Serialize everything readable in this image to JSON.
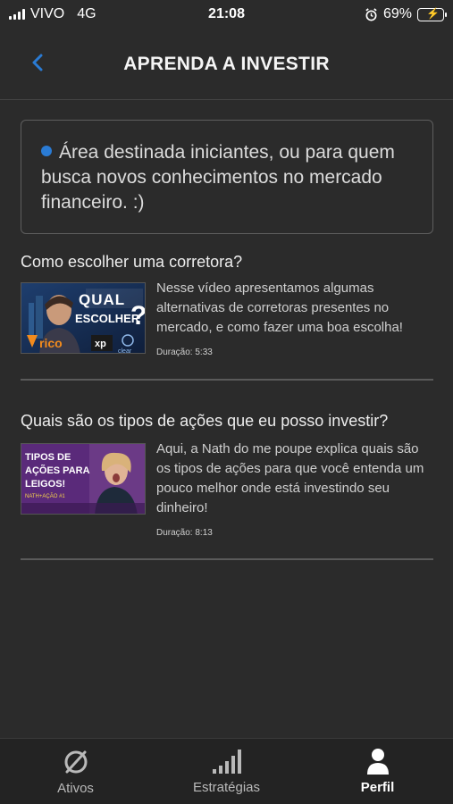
{
  "status_bar": {
    "carrier": "VIVO",
    "network": "4G",
    "time": "21:08",
    "battery": "69%"
  },
  "header": {
    "title": "APRENDA A INVESTIR"
  },
  "info_box": {
    "text": "Área destinada iniciantes, ou para quem busca novos conhecimentos no mercado financeiro. :)"
  },
  "videos": [
    {
      "title": "Como escolher uma corretora?",
      "thumbnail_text": "QUAL ESCOLHER?",
      "thumbnail_brands": [
        "rico",
        "xp",
        "clear"
      ],
      "description": "Nesse vídeo apresentamos algumas alternativas de corretoras presentes no mercado, e como fazer uma boa escolha!",
      "duration": "Duração: 5:33"
    },
    {
      "title": "Quais são os tipos de ações que eu posso investir?",
      "thumbnail_text": "TIPOS DE AÇÕES PARA LEIGOS!",
      "thumbnail_sub": "NATH+AÇÃO #1",
      "description": "Aqui, a Nath do me poupe explica quais são os tipos de ações para que você entenda um pouco melhor onde está investindo seu dinheiro!",
      "duration": "Duração: 8:13"
    }
  ],
  "tab_bar": {
    "tabs": [
      {
        "label": "Ativos",
        "icon": "ativos-icon",
        "active": false
      },
      {
        "label": "Estratégias",
        "icon": "bars-icon",
        "active": false
      },
      {
        "label": "Perfil",
        "icon": "user-icon",
        "active": true
      }
    ]
  },
  "colors": {
    "background": "#2b2b2b",
    "accent": "#2a7bd4",
    "battery": "#3ad45a"
  }
}
